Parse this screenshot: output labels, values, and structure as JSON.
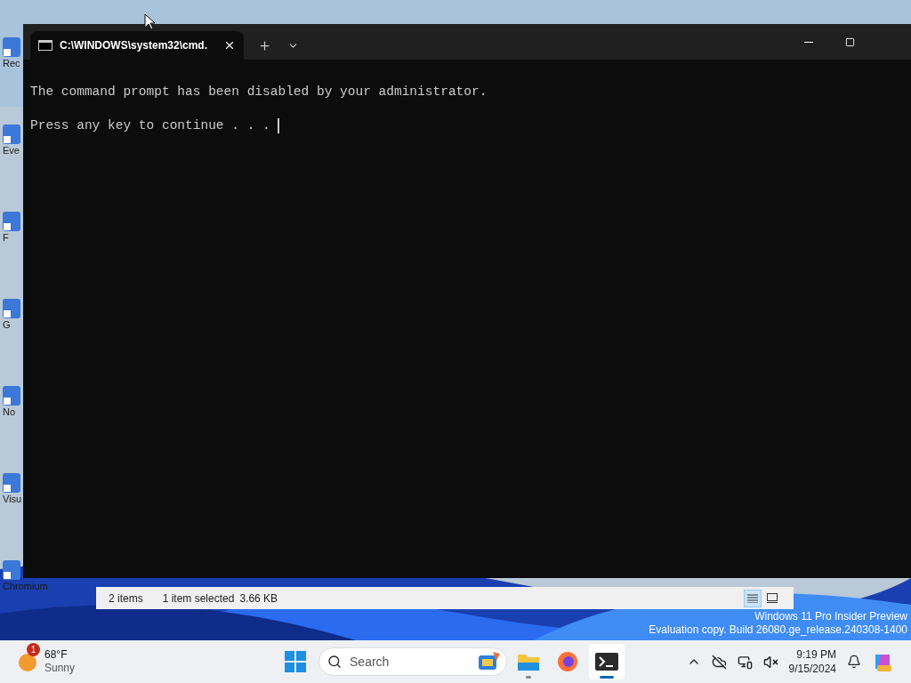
{
  "desktop_icons": [
    {
      "label": "Rec"
    },
    {
      "label": "Eve"
    },
    {
      "label": "F"
    },
    {
      "label": "G"
    },
    {
      "label": "No"
    },
    {
      "label": "Visu"
    },
    {
      "label": "Chromium"
    }
  ],
  "explorer_status_bar": {
    "item_count": "2 items",
    "selection": "1 item selected",
    "size": "3.66 KB",
    "views": [
      {
        "kind": "details",
        "selected": true
      },
      {
        "kind": "tiles",
        "selected": false
      }
    ]
  },
  "terminal": {
    "tab": {
      "title": "C:\\WINDOWS\\system32\\cmd.",
      "selected": true
    },
    "lines": [
      "The command prompt has been disabled by your administrator.",
      "Press any key to continue . . ."
    ],
    "cursor": true
  },
  "watermark": [
    "Windows 11 Pro Insider Preview",
    "Evaluation copy. Build 26080.ge_release.240308-1400"
  ],
  "taskbar": {
    "weather": {
      "badge": "1",
      "temperature": "68°F",
      "condition": "Sunny"
    },
    "search": {
      "placeholder": "Search"
    },
    "apps": [
      {
        "kind": "widgets",
        "running": false,
        "active": false
      },
      {
        "kind": "explorer",
        "running": true,
        "active": false
      },
      {
        "kind": "firefox",
        "running": false,
        "active": false
      },
      {
        "kind": "terminal",
        "running": true,
        "active": true
      }
    ],
    "time": "9:19 PM",
    "date": "9/15/2024"
  }
}
